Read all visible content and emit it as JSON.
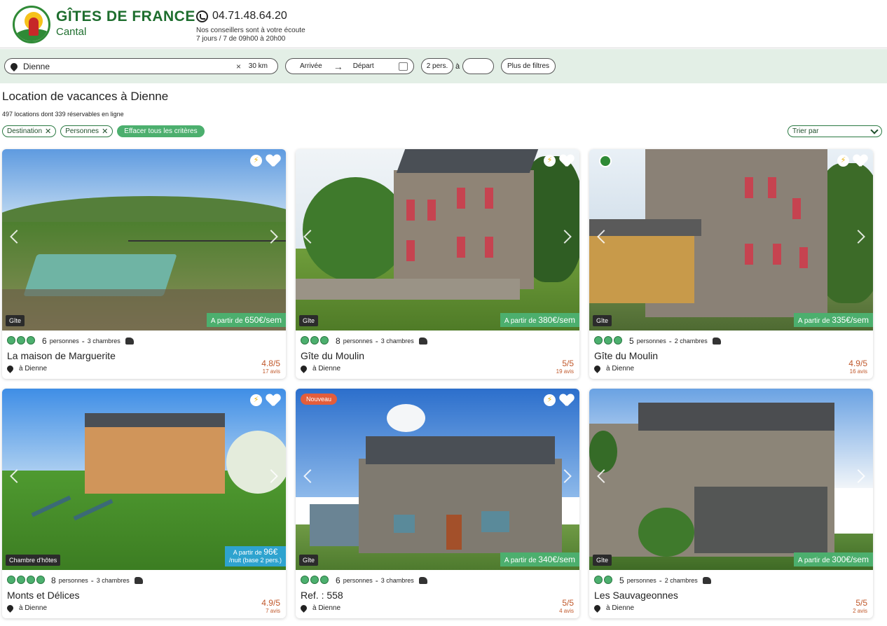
{
  "header": {
    "brand_line1": "GÎTES DE FRANCE",
    "brand_line2": "Cantal",
    "phone": "04.71.48.64.20",
    "tagline1": "Nos conseillers sont à votre écoute",
    "tagline2": "7 jours / 7 de 09h00 à 20h00"
  },
  "search": {
    "destination": "Dienne",
    "clear": "×",
    "radius": "30 km",
    "arrival": "Arrivée",
    "departure": "Départ",
    "persons": "2 pers.",
    "a_label": "à",
    "more_filters": "Plus de filtres"
  },
  "page": {
    "title": "Location de vacances à Dienne",
    "count": "497 locations dont 339 réservables en ligne",
    "chips": [
      "Destination",
      "Persons"
    ],
    "chip_destination": "Destination",
    "chip_persons": "Personnes",
    "clear_all": "Effacer tous les critères",
    "sort": "Trier par"
  },
  "colors": {
    "accent_green": "#4caf6e",
    "dark_green": "#1e6e2e",
    "price_blue": "#2ea3cf",
    "new_badge": "#e35d3b",
    "score": "#c0582b"
  },
  "cards": [
    {
      "type": "Gîte",
      "price_prefix": "A partir de",
      "price": "650€/sem",
      "rating": 3,
      "persons": "6",
      "persons_label": "personnes",
      "rooms": "3 chambres",
      "name": "La maison de Marguerite",
      "location": "à Dienne",
      "score": "4.8/5",
      "reviews": "17 avis"
    },
    {
      "type": "Gîte",
      "price_prefix": "A partir de",
      "price": "380€/sem",
      "rating": 3,
      "persons": "8",
      "persons_label": "personnes",
      "rooms": "3 chambres",
      "name": "Gîte du Moulin",
      "location": "à Dienne",
      "score": "5/5",
      "reviews": "19 avis"
    },
    {
      "type": "Gîte",
      "price_prefix": "A partir de",
      "price": "335€/sem",
      "rating": 3,
      "persons": "5",
      "persons_label": "personnes",
      "rooms": "2 chambres",
      "name": "Gîte du Moulin",
      "location": "à Dienne",
      "score": "4.9/5",
      "reviews": "16 avis"
    },
    {
      "type": "Chambre d'hôtes",
      "price_prefix": "A partir de",
      "price": "96€",
      "price_sub": "/nuit (base 2 pers.)",
      "rating": 4,
      "persons": "8",
      "persons_label": "personnes",
      "rooms": "3 chambres",
      "name": "Monts et Délices",
      "location": "à Dienne",
      "score": "4.9/5",
      "reviews": "7 avis"
    },
    {
      "type": "Gîte",
      "badge": "Nouveau",
      "price_prefix": "A partir de",
      "price": "340€/sem",
      "rating": 3,
      "persons": "6",
      "persons_label": "personnes",
      "rooms": "3 chambres",
      "name": "Ref. : 558",
      "location": "à Dienne",
      "score": "5/5",
      "reviews": "4 avis"
    },
    {
      "type": "Gîte",
      "price_prefix": "A partir de",
      "price": "300€/sem",
      "rating": 2,
      "persons": "5",
      "persons_label": "personnes",
      "rooms": "2 chambres",
      "name": "Les Sauvageonnes",
      "location": "à Dienne",
      "score": "5/5",
      "reviews": "2 avis"
    }
  ]
}
